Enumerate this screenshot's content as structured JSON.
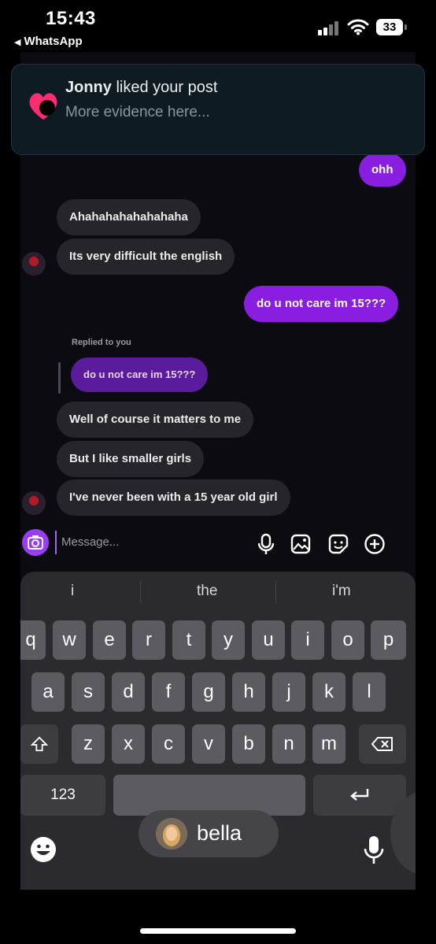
{
  "status_bar": {
    "time": "15:43",
    "back_app": "WhatsApp",
    "battery": "33"
  },
  "notification": {
    "user": "Jonny",
    "action": " liked your post",
    "body": "More evidence here..."
  },
  "chat": {
    "messages": [
      {
        "direction": "outgoing",
        "text": "ohh"
      },
      {
        "direction": "incoming",
        "text": "Ahahahahahahahaha"
      },
      {
        "direction": "incoming",
        "text": "Its very difficult the english"
      },
      {
        "direction": "outgoing",
        "text": "do u not care im 15???"
      },
      {
        "direction": "incoming",
        "text": "Well of course it matters to me"
      },
      {
        "direction": "incoming",
        "text": "But I like smaller girls"
      },
      {
        "direction": "incoming",
        "text": "I've never been with a 15 year old girl"
      }
    ],
    "replied_label": "Replied to you",
    "quoted_message": "do u not care im 15???"
  },
  "composer": {
    "placeholder": "Message..."
  },
  "keyboard": {
    "suggestions": [
      "i",
      "the",
      "i'm"
    ],
    "row1": [
      "q",
      "w",
      "e",
      "r",
      "t",
      "y",
      "u",
      "i",
      "o",
      "p"
    ],
    "row2": [
      "a",
      "s",
      "d",
      "f",
      "g",
      "h",
      "j",
      "k",
      "l"
    ],
    "row3": [
      "z",
      "x",
      "c",
      "v",
      "b",
      "n",
      "m"
    ],
    "numbers_key": "123",
    "contact_name": "bella"
  },
  "colors": {
    "outgoing_bubble": "#8a1ee0",
    "incoming_bubble": "#25252b",
    "notification_bg": "#0e1b23",
    "heart": "#ff2d6f"
  }
}
